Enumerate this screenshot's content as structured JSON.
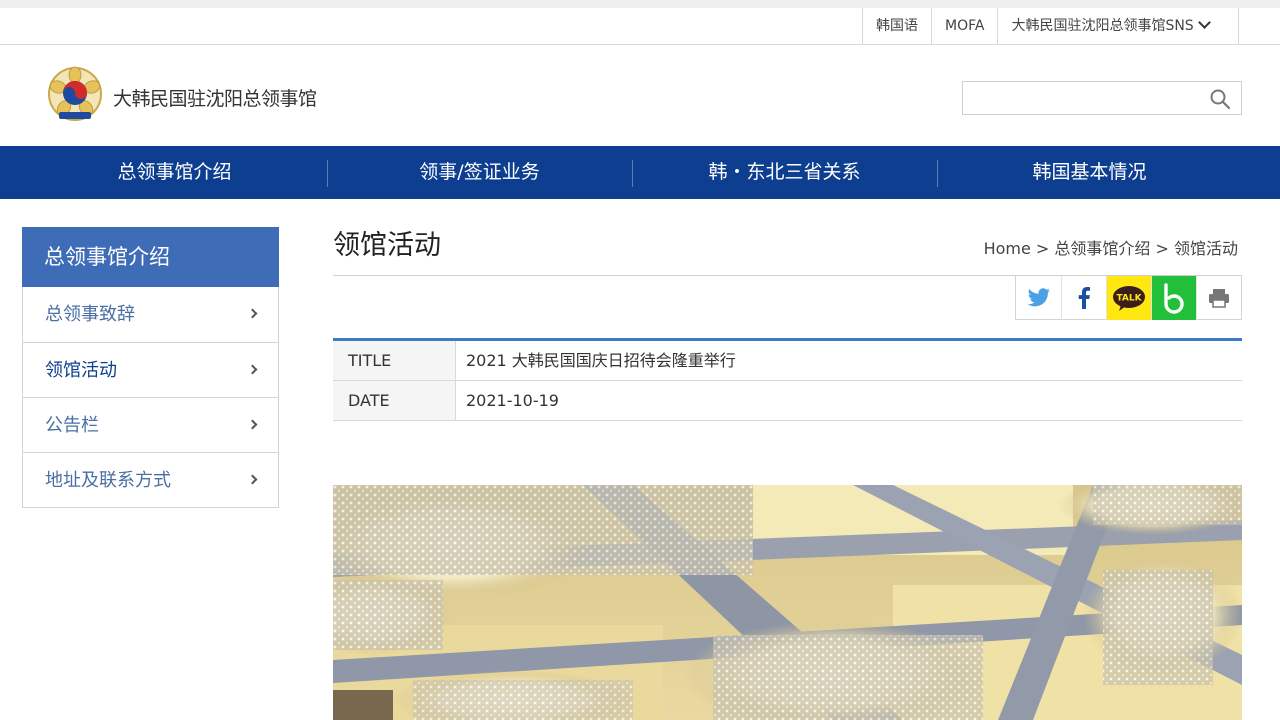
{
  "utility": {
    "links": [
      "韩国语",
      "MOFA",
      "大韩民国驻沈阳总领事馆SNS"
    ]
  },
  "header": {
    "site_title": "大韩民国驻沈阳总领事馆",
    "search_placeholder": ""
  },
  "nav": {
    "items": [
      "总领事馆介绍",
      "领事/签证业务",
      "韩・东北三省关系",
      "韩国基本情况"
    ]
  },
  "sidebar": {
    "heading": "总领事馆介绍",
    "items": [
      "总领事致辞",
      "领馆活动",
      "公告栏",
      "地址及联系方式"
    ]
  },
  "content": {
    "page_title": "领馆活动",
    "breadcrumb": "Home > 总领事馆介绍 > 领馆活动",
    "share": {
      "icons": [
        "twitter-icon",
        "facebook-icon",
        "kakaotalk-icon",
        "band-icon",
        "print-icon"
      ],
      "kakao_label": "TALK"
    },
    "info": [
      {
        "key": "TITLE",
        "value": "2021 大韩民国国庆日招待会隆重举行"
      },
      {
        "key": "DATE",
        "value": "2021-10-19"
      }
    ]
  },
  "colors": {
    "nav_bg": "#0d3e8f",
    "sidebar_head_bg": "#3f6cb7",
    "table_accent": "#3f79c9",
    "kakao_yellow": "#ffe812",
    "band_green": "#22c03a"
  }
}
